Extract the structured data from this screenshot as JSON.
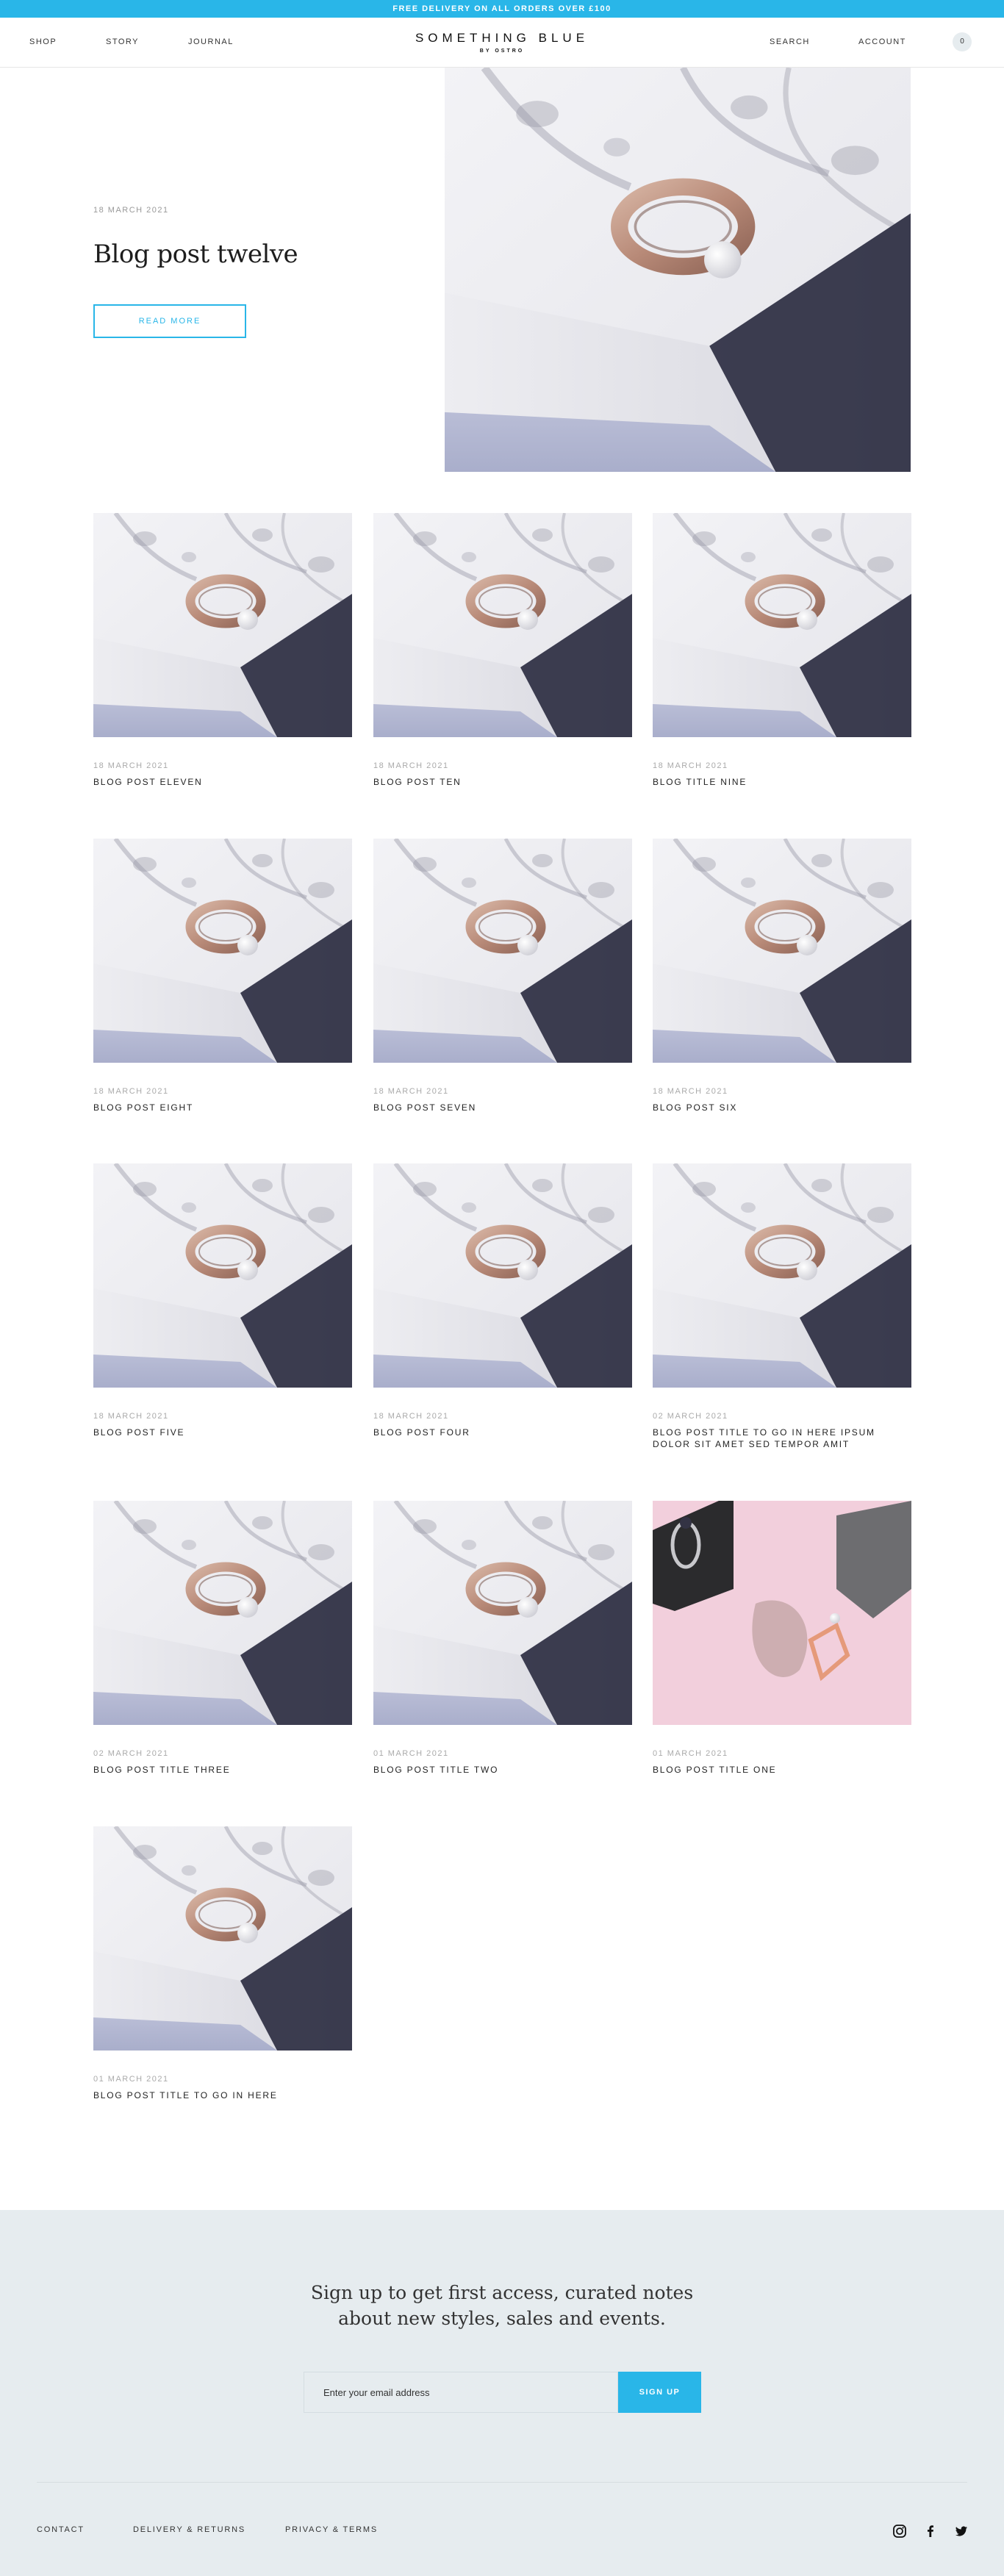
{
  "announcement": "FREE DELIVERY ON ALL ORDERS OVER £100",
  "nav": {
    "shop": "SHOP",
    "story": "STORY",
    "journal": "JOURNAL",
    "search": "SEARCH",
    "account": "ACCOUNT",
    "cart_count": "0"
  },
  "brand": {
    "name": "SOMETHING BLUE",
    "sub": "BY OSTRO"
  },
  "hero": {
    "date": "18 MARCH 2021",
    "title": "Blog post twelve",
    "cta": "READ MORE"
  },
  "posts": [
    {
      "date": "18 MARCH 2021",
      "title": "BLOG POST ELEVEN",
      "image": "ring-white-box"
    },
    {
      "date": "18 MARCH 2021",
      "title": "BLOG POST TEN",
      "image": "ring-white-box"
    },
    {
      "date": "18 MARCH 2021",
      "title": "BLOG TITLE NINE",
      "image": "ring-white-box"
    },
    {
      "date": "18 MARCH 2021",
      "title": "BLOG POST EIGHT",
      "image": "ring-white-box"
    },
    {
      "date": "18 MARCH 2021",
      "title": "BLOG POST SEVEN",
      "image": "ring-white-box"
    },
    {
      "date": "18 MARCH 2021",
      "title": "BLOG POST SIX",
      "image": "ring-white-box"
    },
    {
      "date": "18 MARCH 2021",
      "title": "BLOG POST FIVE",
      "image": "ring-white-box"
    },
    {
      "date": "18 MARCH 2021",
      "title": "BLOG POST FOUR",
      "image": "ring-white-box"
    },
    {
      "date": "02 MARCH 2021",
      "title": "BLOG POST TITLE TO GO IN HERE IPSUM DOLOR SIT AMET SED TEMPOR AMIT",
      "image": "ring-white-box"
    },
    {
      "date": "02 MARCH 2021",
      "title": "BLOG POST TITLE THREE",
      "image": "ring-white-box"
    },
    {
      "date": "01 MARCH 2021",
      "title": "BLOG POST TITLE TWO",
      "image": "ring-white-box"
    },
    {
      "date": "01 MARCH 2021",
      "title": "BLOG POST TITLE ONE",
      "image": "rings-pink"
    },
    {
      "date": "01 MARCH 2021",
      "title": "BLOG POST TITLE TO GO IN HERE",
      "image": "ring-white-box"
    }
  ],
  "newsletter": {
    "heading_line1": "Sign up to get first access, curated notes",
    "heading_line2": "about new styles, sales and events.",
    "placeholder": "Enter your email address",
    "button": "SIGN UP"
  },
  "footer": {
    "links": [
      "CONTACT",
      "DELIVERY & RETURNS",
      "PRIVACY & TERMS"
    ],
    "social_icons": [
      "instagram-icon",
      "facebook-icon",
      "twitter-icon"
    ]
  },
  "colors": {
    "accent": "#29b6e8",
    "newsletter_bg": "#e6ecef"
  }
}
